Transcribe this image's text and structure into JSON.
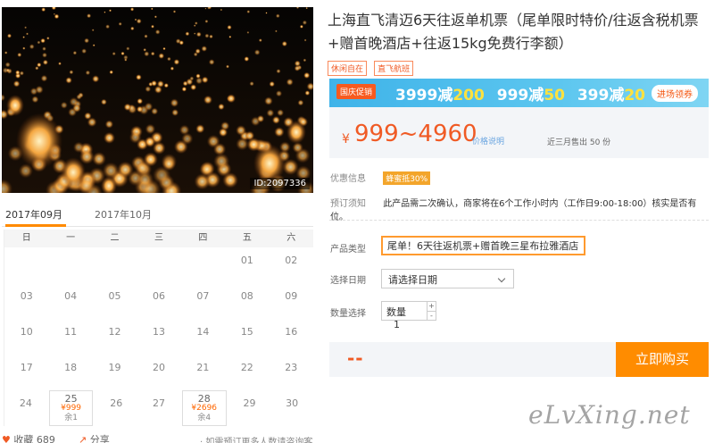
{
  "hero": {
    "image_id": "ID:2097336"
  },
  "calendar": {
    "tabs": [
      "2017年09月",
      "2017年10月"
    ],
    "weekdays": [
      "日",
      "一",
      "二",
      "三",
      "四",
      "五",
      "六"
    ],
    "rows": [
      [
        {
          "d": ""
        },
        {
          "d": ""
        },
        {
          "d": ""
        },
        {
          "d": ""
        },
        {
          "d": ""
        },
        {
          "d": "01"
        },
        {
          "d": "02"
        }
      ],
      [
        {
          "d": "03"
        },
        {
          "d": "04"
        },
        {
          "d": "05"
        },
        {
          "d": "06"
        },
        {
          "d": "07"
        },
        {
          "d": "08"
        },
        {
          "d": "09"
        }
      ],
      [
        {
          "d": "10"
        },
        {
          "d": "11"
        },
        {
          "d": "12"
        },
        {
          "d": "13"
        },
        {
          "d": "14"
        },
        {
          "d": "15"
        },
        {
          "d": "16"
        }
      ],
      [
        {
          "d": "17"
        },
        {
          "d": "18"
        },
        {
          "d": "19"
        },
        {
          "d": "20"
        },
        {
          "d": "21"
        },
        {
          "d": "22"
        },
        {
          "d": "23"
        }
      ],
      [
        {
          "d": "24"
        },
        {
          "d": "25",
          "price": "¥999",
          "stock": "余1"
        },
        {
          "d": "26"
        },
        {
          "d": "27"
        },
        {
          "d": "28",
          "price": "¥2696",
          "stock": "余4"
        },
        {
          "d": "29"
        },
        {
          "d": "30"
        }
      ]
    ]
  },
  "left_footer": {
    "favorites": "收藏 689",
    "share": "分享",
    "consult": "· 如需预订更多人数请咨询客服"
  },
  "product": {
    "title": "上海直飞清迈6天往返单机票（尾单限时特价/往返含税机票+赠首晚酒店+往返15kg免费行李额）",
    "tags": [
      "休闲自在",
      "直飞航班"
    ]
  },
  "promo": {
    "badge": "国庆促销",
    "deals": [
      {
        "spend": "3999减",
        "save": "200"
      },
      {
        "spend": "999减",
        "save": "50"
      },
      {
        "spend": "399减",
        "save": "20"
      }
    ],
    "coupon": "进场领券"
  },
  "price": {
    "yen": "¥",
    "range": "999~4960",
    "note": "价格说明",
    "sold": "近三月售出 50 份"
  },
  "offers": {
    "label": "优惠信息",
    "badge": "蜂蜜抵30%"
  },
  "notice": {
    "label": "预订须知",
    "text": "此产品需二次确认，商家将在6个工作小时内（工作日9:00-18:00）核实是否有位。"
  },
  "form": {
    "type_label": "产品类型",
    "type_value": "尾单！6天往返机票+赠首晚三星布拉雅酒店",
    "date_label": "选择日期",
    "date_value": "请选择日期",
    "qty_label": "数量选择",
    "qty_text": "数量",
    "qty_value": "1",
    "plus": "+",
    "minus": "-"
  },
  "buy": {
    "total": "--",
    "button": "立即购买"
  },
  "watermark": "eLvXing.net",
  "colors": {
    "accent": "#ff8c00",
    "price": "#f05a24",
    "promo_blue": "#3fb3e9",
    "promo_yellow": "#ffe23e"
  }
}
